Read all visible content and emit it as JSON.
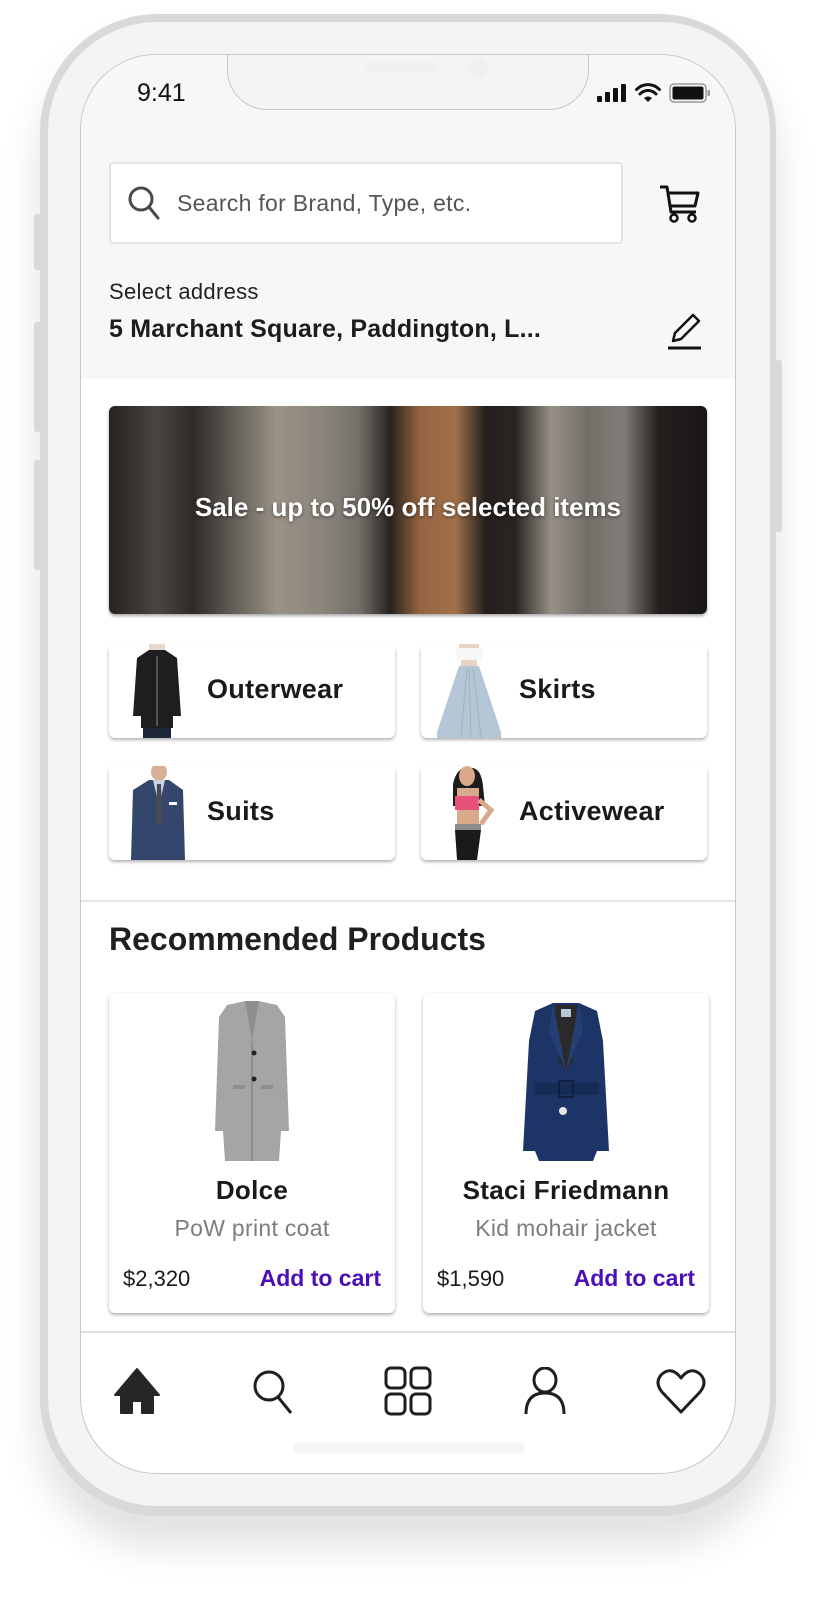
{
  "status_bar": {
    "time": "9:41"
  },
  "search": {
    "placeholder": "Search for Brand, Type, etc.",
    "value": ""
  },
  "address": {
    "label": "Select address",
    "value": "5 Marchant Square, Paddington, L..."
  },
  "banner": {
    "text": "Sale - up to 50% off selected items"
  },
  "categories": [
    {
      "label": "Outerwear",
      "icon": "jacket-photo"
    },
    {
      "label": "Skirts",
      "icon": "skirt-photo"
    },
    {
      "label": "Suits",
      "icon": "suit-photo"
    },
    {
      "label": "Activewear",
      "icon": "activewear-photo"
    }
  ],
  "recommended": {
    "title": "Recommended Products",
    "products": [
      {
        "brand": "Dolce",
        "description": "PoW print coat",
        "price": "$2,320",
        "action": "Add to cart",
        "image": "grey-coat-photo"
      },
      {
        "brand": "Staci Friedmann",
        "description": "Kid mohair jacket",
        "price": "$1,590",
        "action": "Add to cart",
        "image": "navy-jacket-photo"
      }
    ]
  },
  "bottom_nav": [
    {
      "name": "home",
      "icon": "home-icon",
      "active": true
    },
    {
      "name": "search",
      "icon": "search-icon",
      "active": false
    },
    {
      "name": "categories",
      "icon": "grid-icon",
      "active": false
    },
    {
      "name": "profile",
      "icon": "user-icon",
      "active": false
    },
    {
      "name": "favorites",
      "icon": "heart-icon",
      "active": false
    }
  ],
  "colors": {
    "accent": "#4b0fb5",
    "text": "#1f1f1f",
    "muted": "#7d7d7d"
  }
}
